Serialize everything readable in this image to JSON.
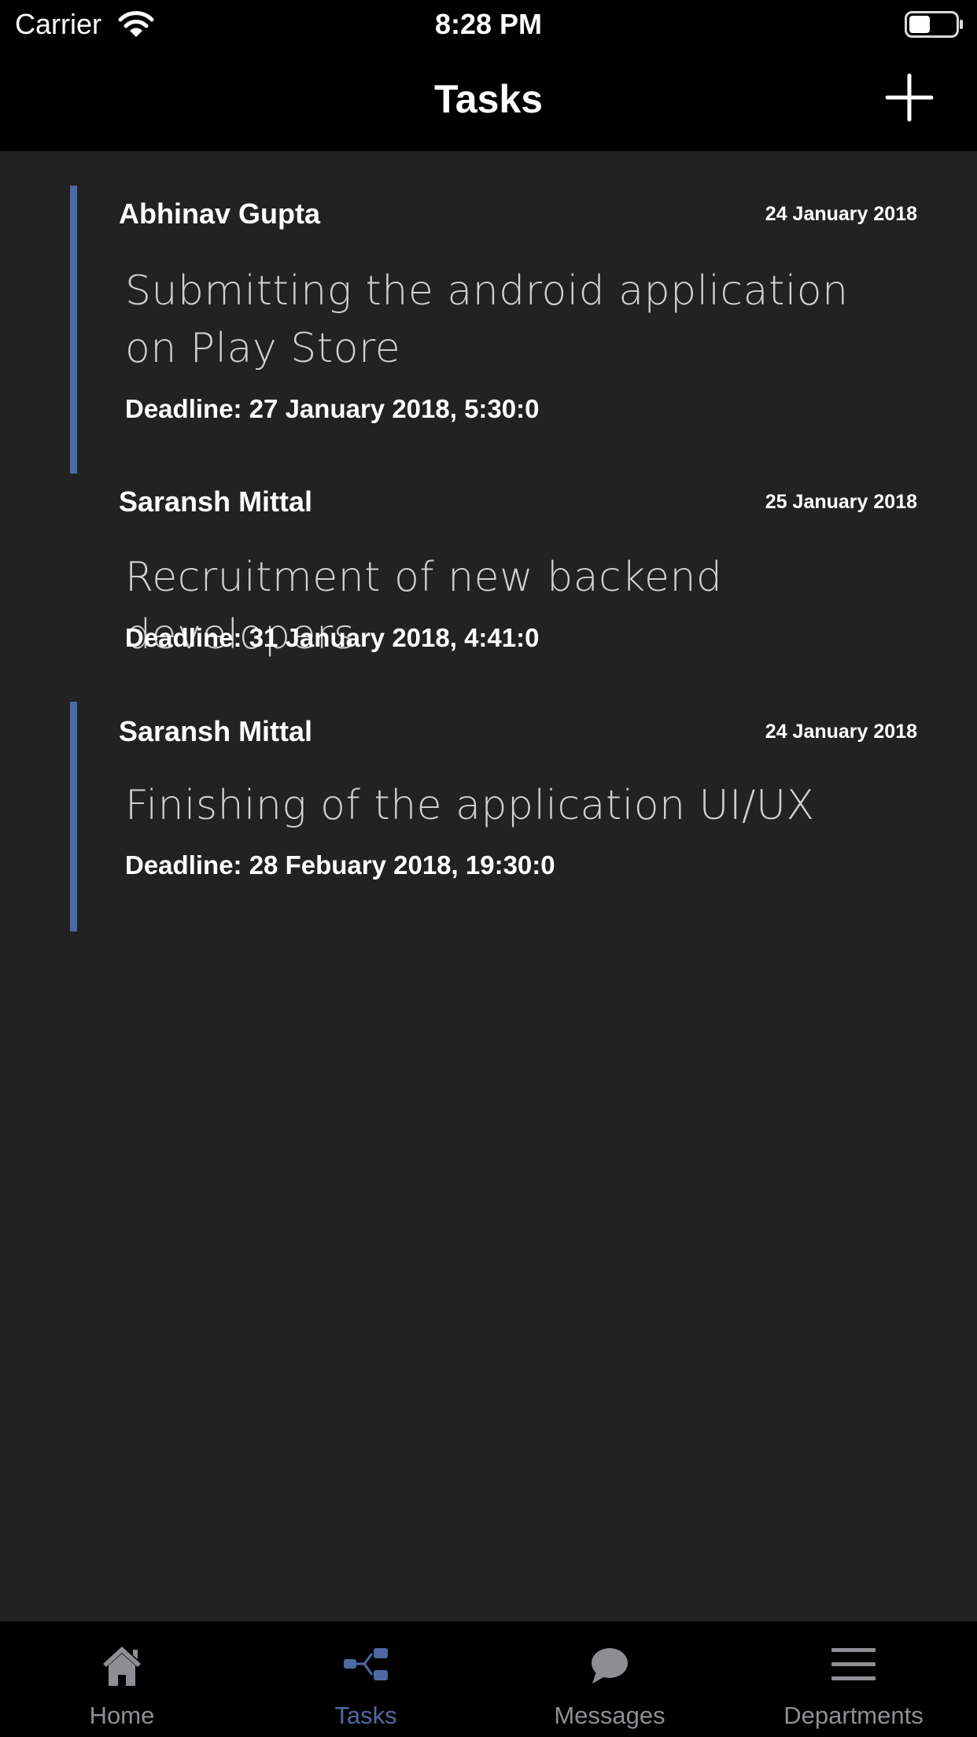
{
  "status_bar": {
    "carrier": "Carrier",
    "time": "8:28 PM"
  },
  "nav": {
    "title": "Tasks",
    "add_icon": "plus-icon"
  },
  "colors": {
    "accent": "#4f6aa3",
    "background": "#222222",
    "bar_background": "#000000",
    "inactive_tab": "#8e8e93"
  },
  "tasks": [
    {
      "author": "Abhinav Gupta",
      "date": "24 January 2018",
      "title": "Submitting the android application on Play Store",
      "deadline": "Deadline: 27 January 2018, 5:30:0",
      "highlighted": true
    },
    {
      "author": "Saransh Mittal",
      "date": "25 January 2018",
      "title": "Recruitment of new backend developers",
      "deadline": "Deadline: 31 January 2018, 4:41:0",
      "highlighted": false
    },
    {
      "author": "Saransh Mittal",
      "date": "24 January 2018",
      "title": "Finishing of the application UI/UX",
      "deadline": "Deadline: 28 Febuary 2018, 19:30:0",
      "highlighted": true
    }
  ],
  "tab_bar": {
    "active": "Tasks",
    "tabs": [
      {
        "label": "Home",
        "icon": "home-icon"
      },
      {
        "label": "Tasks",
        "icon": "hierarchy-icon"
      },
      {
        "label": "Messages",
        "icon": "speech-bubble-icon"
      },
      {
        "label": "Departments",
        "icon": "menu-icon"
      }
    ]
  }
}
